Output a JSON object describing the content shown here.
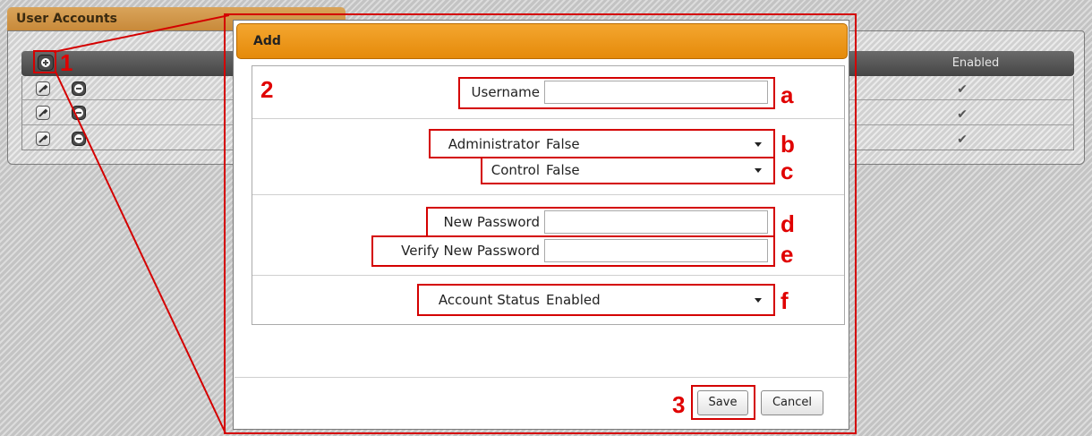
{
  "panel": {
    "title": "User Accounts",
    "column_enabled": "Enabled",
    "rows": [
      {
        "enabled_mark": "✔"
      },
      {
        "enabled_mark": "✔"
      },
      {
        "enabled_mark": "✔"
      }
    ]
  },
  "dialog": {
    "title": "Add",
    "fields": {
      "username_label": "Username",
      "username_value": "",
      "administrator_label": "Administrator",
      "administrator_value": "False",
      "control_label": "Control",
      "control_value": "False",
      "new_password_label": "New Password",
      "new_password_value": "",
      "verify_password_label": "Verify New Password",
      "verify_password_value": "",
      "account_status_label": "Account Status",
      "account_status_value": "Enabled"
    },
    "buttons": {
      "save": "Save",
      "cancel": "Cancel"
    }
  },
  "callouts": {
    "n1": "1",
    "n2": "2",
    "n3": "3",
    "a": "a",
    "b": "b",
    "c": "c",
    "d": "d",
    "e": "e",
    "f": "f"
  },
  "colors": {
    "accent_orange": "#e8900f",
    "callout_red": "#d40000"
  },
  "icons": [
    "add-icon",
    "wrench-icon",
    "remove-icon",
    "checkmark-icon",
    "dropdown-caret-icon"
  ]
}
